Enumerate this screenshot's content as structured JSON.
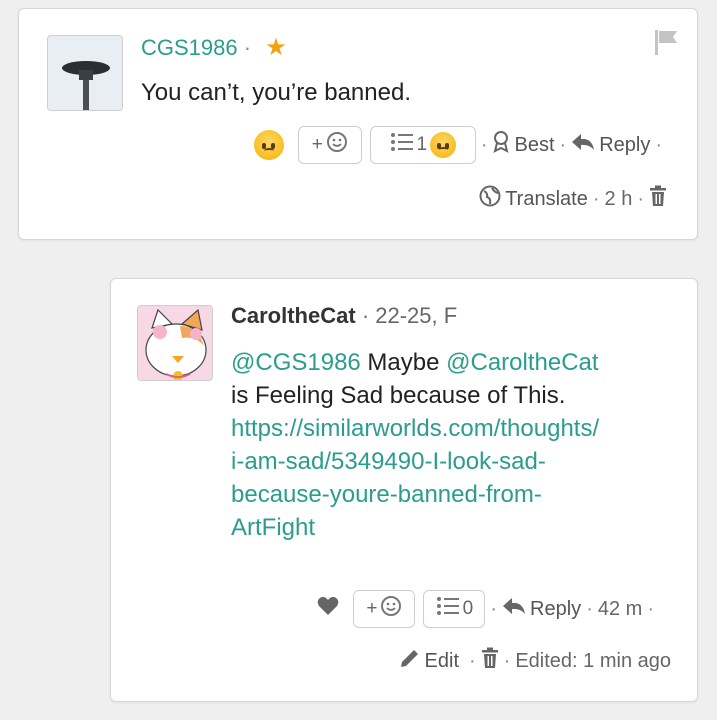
{
  "comment1": {
    "author": "CGS1986",
    "author_sep": "·",
    "text": "You can’t, you’re banned.",
    "add_reaction_label": "+",
    "reactions_count": "1",
    "best_label": "Best",
    "reply_label": "Reply",
    "translate_label": "Translate",
    "time": "2 h",
    "dot": "·"
  },
  "comment2": {
    "author": "CaroltheCat",
    "author_meta": "· 22-25, F",
    "mention1": "@CGS1986",
    "text_mid": " Maybe ",
    "mention2": "@CaroltheCat",
    "text_after": "is Feeling Sad because of This.",
    "link_lines": [
      "https://similarworlds.com/thoughts/",
      "i-am-sad/5349490-I-look-sad-",
      "because-youre-banned-from-",
      "ArtFight"
    ],
    "add_reaction_label": "+",
    "reactions_count": "0",
    "reply_label": "Reply",
    "time": "42 m",
    "edit_label": "Edit",
    "edited_label": "Edited: 1 min ago",
    "dot": "·"
  },
  "colors": {
    "accent": "#2a9d8f",
    "star": "#f0a30a",
    "background": "#efefef"
  },
  "icons": [
    "flag-icon",
    "star-icon",
    "sad-face-emoji",
    "add-emoji-icon",
    "list-icon",
    "award-icon",
    "reply-icon",
    "globe-icon",
    "trash-icon",
    "heart-icon",
    "pencil-icon"
  ]
}
